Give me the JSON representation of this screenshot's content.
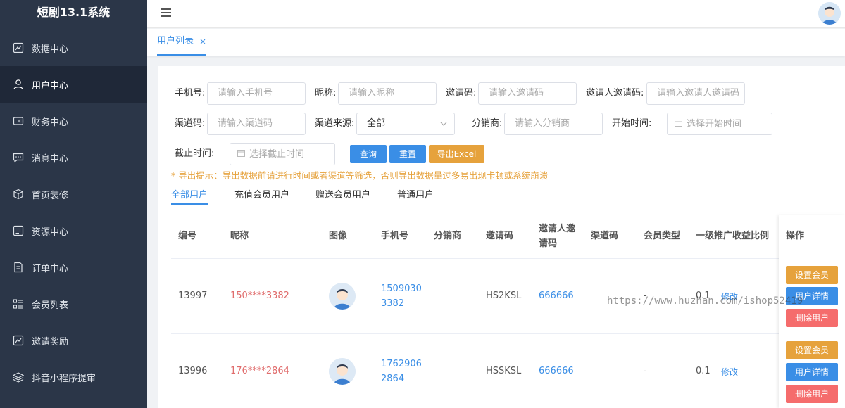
{
  "app": {
    "title": "短剧13.1系统"
  },
  "sidebar": {
    "items": [
      {
        "label": "数据中心",
        "icon": "chart-line-icon"
      },
      {
        "label": "用户中心",
        "icon": "user-icon"
      },
      {
        "label": "财务中心",
        "icon": "wallet-icon"
      },
      {
        "label": "消息中心",
        "icon": "message-icon"
      },
      {
        "label": "首页装修",
        "icon": "cube-icon"
      },
      {
        "label": "资源中心",
        "icon": "resource-icon"
      },
      {
        "label": "订单中心",
        "icon": "document-icon"
      },
      {
        "label": "会员列表",
        "icon": "list-icon"
      },
      {
        "label": "邀请奖励",
        "icon": "chart-line-icon"
      },
      {
        "label": "抖音小程序提审",
        "icon": "layers-icon"
      }
    ],
    "active_index": 1
  },
  "tabs": {
    "active_label": "用户列表",
    "close_glyph": "×"
  },
  "filters": {
    "phone_label": "手机号:",
    "phone_placeholder": "请输入手机号",
    "nickname_label": "昵称:",
    "nickname_placeholder": "请输入昵称",
    "invite_code_label": "邀请码:",
    "invite_code_placeholder": "请输入邀请码",
    "inviter_code_label": "邀请人邀请码:",
    "inviter_code_placeholder": "请输入邀请人邀请码",
    "channel_code_label": "渠道码:",
    "channel_code_placeholder": "请输入渠道码",
    "channel_source_label": "渠道来源:",
    "channel_source_value": "全部",
    "distributor_label": "分销商:",
    "distributor_placeholder": "请输入分销商",
    "start_time_label": "开始时间:",
    "start_time_placeholder": "选择开始时间",
    "end_time_label": "截止时间:",
    "end_time_placeholder": "选择截止时间"
  },
  "buttons": {
    "query": "查询",
    "reset": "重置",
    "export": "导出Excel"
  },
  "hint": "* 导出提示：导出数据前请进行时间或者渠道等筛选，否则导出数据量过多易出现卡顿或系统崩溃",
  "user_tabs": [
    "全部用户",
    "充值会员用户",
    "赠送会员用户",
    "普通用户"
  ],
  "table": {
    "headers": {
      "id": "编号",
      "nickname": "昵称",
      "avatar": "图像",
      "phone": "手机号",
      "distributor": "分销商",
      "invite_code": "邀请码",
      "inviter_code_line1": "邀请人邀",
      "inviter_code_line2": "请码",
      "channel_code": "渠道码",
      "member_type": "会员类型",
      "commission_ratio": "一级推广收益比例",
      "actions": "操作"
    },
    "rows": [
      {
        "id": "13997",
        "nickname": "150****3382",
        "phone_line1": "1509030",
        "phone_line2": "3382",
        "invite_code": "HS2KSL",
        "inviter_code": "666666",
        "member_type": "-",
        "ratio": "0.1",
        "edit": "修改"
      },
      {
        "id": "13996",
        "nickname": "176****2864",
        "phone_line1": "1762906",
        "phone_line2": "2864",
        "invite_code": "HSSKSL",
        "inviter_code": "666666",
        "member_type": "-",
        "ratio": "0.1",
        "edit": "修改"
      }
    ],
    "row_actions": {
      "set_member": "设置会员",
      "user_detail": "用户详情",
      "delete_user": "删除用户"
    }
  },
  "watermark": "https://www.huzhan.com/ishop52419"
}
